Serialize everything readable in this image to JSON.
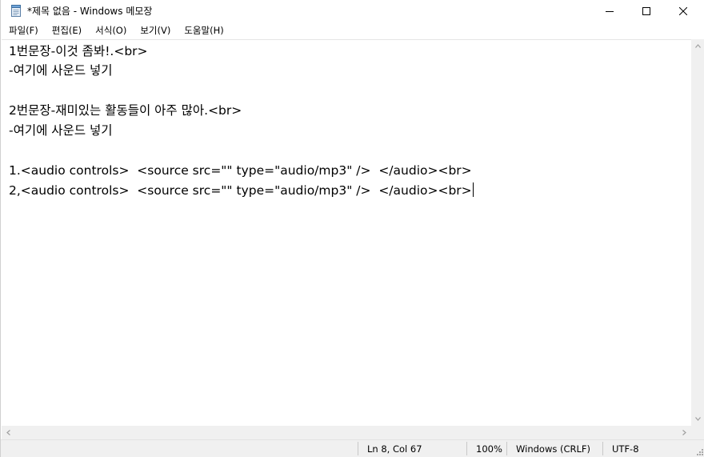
{
  "window": {
    "title": "*제목 없음 - Windows 메모장",
    "icon": "notepad-icon",
    "controls": {
      "minimize_icon": "minimize-icon",
      "maximize_icon": "maximize-icon",
      "close_icon": "close-icon"
    }
  },
  "menu": {
    "items": [
      {
        "label": "파일(F)"
      },
      {
        "label": "편집(E)"
      },
      {
        "label": "서식(O)"
      },
      {
        "label": "보기(V)"
      },
      {
        "label": "도움말(H)"
      }
    ]
  },
  "editor": {
    "lines": [
      "1번문장-이것 좀봐!.<br>",
      "-여기에 사운드 넣기",
      "",
      "2번문장-재미있는 활동들이 아주 많아.<br>",
      "-여기에 사운드 넣기",
      "",
      "1.<audio controls>  <source src=\"\" type=\"audio/mp3\" />  </audio><br>",
      "2,<audio controls>  <source src=\"\" type=\"audio/mp3\" />  </audio><br>"
    ]
  },
  "status": {
    "position": "Ln 8, Col 67",
    "zoom": "100%",
    "line_ending": "Windows (CRLF)",
    "encoding": "UTF-8"
  },
  "colors": {
    "background": "#ffffff",
    "chrome": "#f0f0f0",
    "text": "#000000"
  }
}
